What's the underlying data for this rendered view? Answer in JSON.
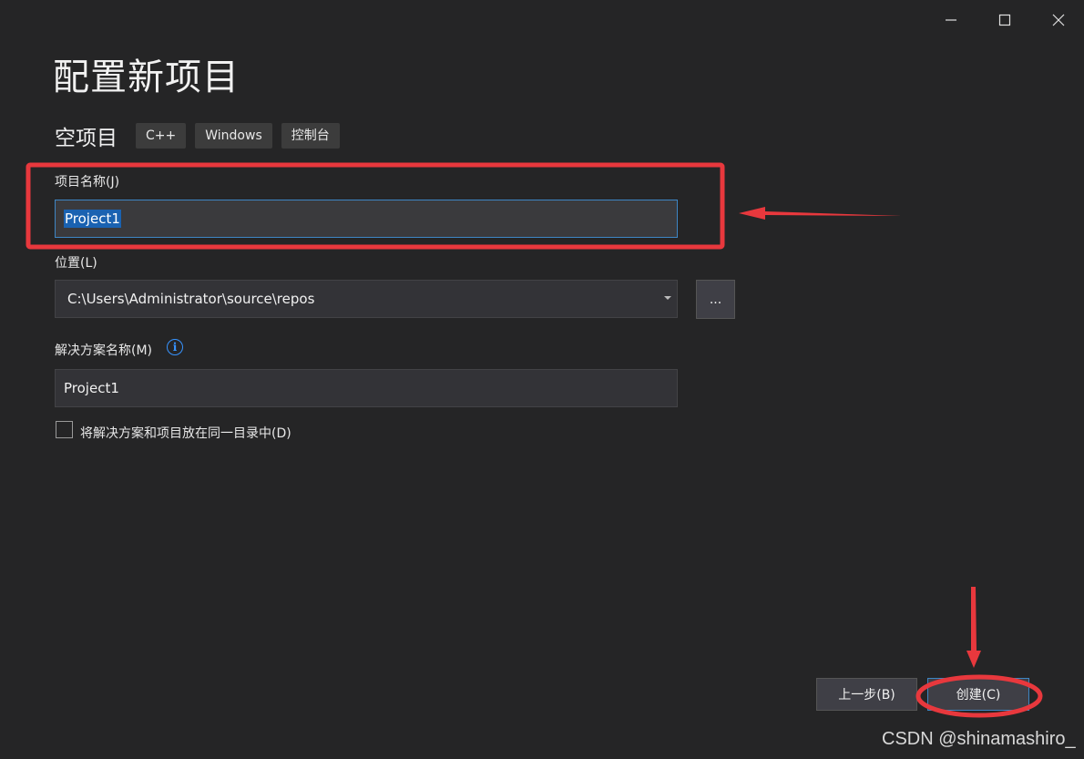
{
  "window": {
    "minimize_icon": "minimize-icon",
    "maximize_icon": "maximize-icon",
    "close_icon": "close-icon"
  },
  "header": {
    "title": "配置新项目",
    "template_name": "空项目",
    "tags": [
      "C++",
      "Windows",
      "控制台"
    ]
  },
  "form": {
    "project_name": {
      "label": "项目名称(J)",
      "value": "Project1"
    },
    "location": {
      "label": "位置(L)",
      "value": "C:\\Users\\Administrator\\source\\repos",
      "browse_label": "..."
    },
    "solution_name": {
      "label": "解决方案名称(M)",
      "value": "Project1",
      "info_glyph": "i"
    },
    "same_dir_checkbox": {
      "label": "将解决方案和项目放在同一目录中(D)",
      "checked": false
    }
  },
  "footer": {
    "back_label": "上一步(B)",
    "create_label": "创建(C)"
  },
  "annotation_colors": {
    "highlight": "#e8383d",
    "focus_border": "#3e86c4",
    "selection": "#1a62b1"
  },
  "watermark": "CSDN @shinamashiro_"
}
